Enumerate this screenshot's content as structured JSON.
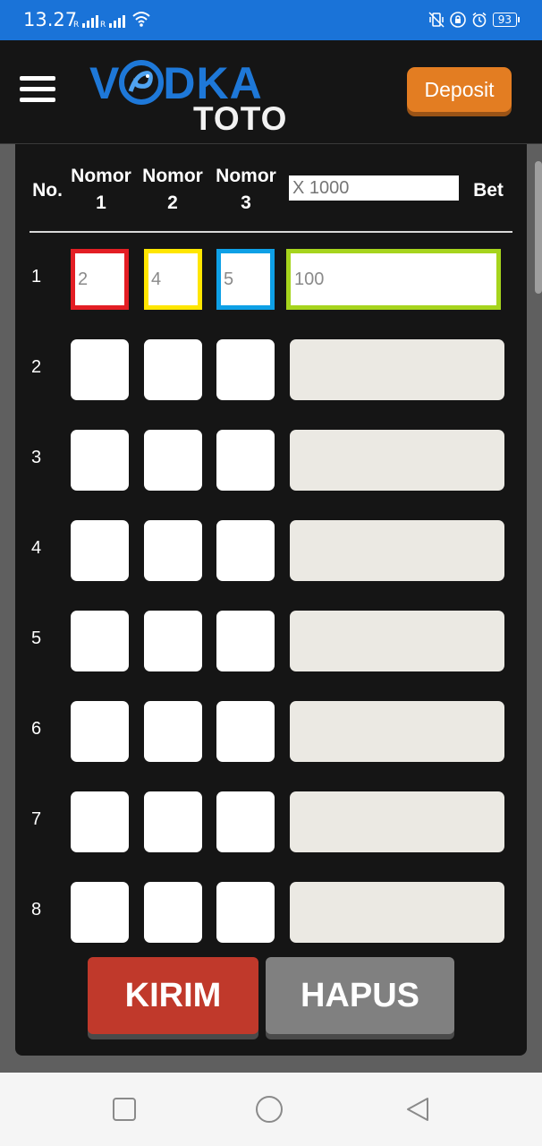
{
  "status_bar": {
    "time": "13.27",
    "battery": "93"
  },
  "header": {
    "logo_top_left": "V",
    "logo_top_right": "DKA",
    "logo_bottom": "TOTO",
    "deposit_label": "Deposit"
  },
  "table": {
    "header": {
      "no": "No.",
      "nomor1_line1": "Nomor",
      "nomor1_line2": "1",
      "nomor2_line1": "Nomor",
      "nomor2_line2": "2",
      "nomor3_line1": "Nomor",
      "nomor3_line2": "3",
      "multiplier_placeholder": "X 1000",
      "bet": "Bet"
    },
    "rows": [
      {
        "no": "1",
        "n1": "2",
        "n2": "4",
        "n3": "5",
        "bet": "100"
      },
      {
        "no": "2",
        "n1": "",
        "n2": "",
        "n3": "",
        "bet": ""
      },
      {
        "no": "3",
        "n1": "",
        "n2": "",
        "n3": "",
        "bet": ""
      },
      {
        "no": "4",
        "n1": "",
        "n2": "",
        "n3": "",
        "bet": ""
      },
      {
        "no": "5",
        "n1": "",
        "n2": "",
        "n3": "",
        "bet": ""
      },
      {
        "no": "6",
        "n1": "",
        "n2": "",
        "n3": "",
        "bet": ""
      },
      {
        "no": "7",
        "n1": "",
        "n2": "",
        "n3": "",
        "bet": ""
      },
      {
        "no": "8",
        "n1": "",
        "n2": "",
        "n3": "",
        "bet": ""
      }
    ]
  },
  "actions": {
    "kirim": "KIRIM",
    "hapus": "HAPUS"
  },
  "colors": {
    "accent_blue": "#1e78d8",
    "deposit_orange": "#e37d22",
    "kirim_red": "#c0392b",
    "hapus_gray": "#808080",
    "highlight_n1": "#e31e24",
    "highlight_n2": "#ffe600",
    "highlight_n3": "#0ea0e6",
    "highlight_bet": "#a6d41d"
  },
  "icons": {
    "menu": "hamburger-menu-icon",
    "wifi": "wifi-icon",
    "nav_recent": "square-icon",
    "nav_home": "circle-icon",
    "nav_back": "triangle-back-icon"
  }
}
